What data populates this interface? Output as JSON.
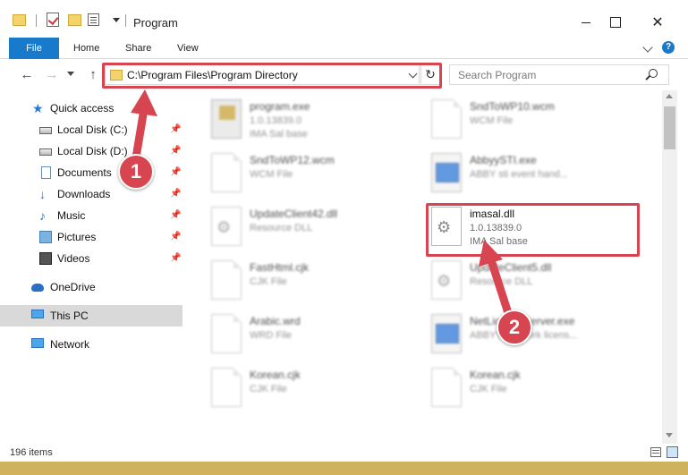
{
  "window": {
    "title": "Program",
    "minimize_label": "",
    "close_glyph": "✕"
  },
  "ribbon": {
    "tabs": [
      "File",
      "Home",
      "Share",
      "View"
    ],
    "help_glyph": "?"
  },
  "address_bar": {
    "path": "C:\\Program Files\\Program Directory",
    "refresh_glyph": "↻"
  },
  "search": {
    "placeholder": "Search Program"
  },
  "nav_glyphs": {
    "back": "←",
    "forward": "→",
    "up": "↑"
  },
  "nav_pane": {
    "items": [
      {
        "label": "Quick access",
        "icon": "star-icon",
        "pinned": false
      },
      {
        "label": "Local Disk (C:)",
        "icon": "drive-icon",
        "pinned": true
      },
      {
        "label": "Local Disk (D:)",
        "icon": "drive-icon",
        "pinned": true
      },
      {
        "label": "Documents",
        "icon": "documents-icon",
        "pinned": true
      },
      {
        "label": "Downloads",
        "icon": "download-icon",
        "pinned": true
      },
      {
        "label": "Music",
        "icon": "music-icon",
        "pinned": true
      },
      {
        "label": "Pictures",
        "icon": "pictures-icon",
        "pinned": true
      },
      {
        "label": "Videos",
        "icon": "videos-icon",
        "pinned": true
      },
      {
        "label": "OneDrive",
        "icon": "cloud-icon",
        "pinned": false
      },
      {
        "label": "This PC",
        "icon": "computer-icon",
        "pinned": false,
        "selected": true
      },
      {
        "label": "Network",
        "icon": "network-icon",
        "pinned": false
      }
    ],
    "pin_glyph": "📌"
  },
  "files": [
    {
      "name": "program.exe",
      "line2": "1.0.13839.0",
      "line3": "IMA Sal base",
      "icon": "program-icon"
    },
    {
      "name": "SndToWP10.wcm",
      "line2": "WCM File",
      "line3": "",
      "icon": "document-icon"
    },
    {
      "name": "SndToWP12.wcm",
      "line2": "WCM File",
      "line3": "",
      "icon": "document-icon"
    },
    {
      "name": "AbbyySTI.exe",
      "line2": "ABBY sti event hand...",
      "line3": "",
      "icon": "exe-icon"
    },
    {
      "name": "UpdateClient42.dll",
      "line2": "Resource DLL",
      "line3": "",
      "icon": "dll-icon"
    },
    {
      "name": "imasal.dll",
      "line2": "1.0.13839.0",
      "line3": "IMA Sal base",
      "icon": "dll-icon"
    },
    {
      "name": "FastHtml.cjk",
      "line2": "CJK File",
      "line3": "",
      "icon": "document-icon"
    },
    {
      "name": "UpdateClient5.dll",
      "line2": "Resource DLL",
      "line3": "",
      "icon": "dll-icon"
    },
    {
      "name": "Arabic.wrd",
      "line2": "WRD File",
      "line3": "",
      "icon": "document-icon"
    },
    {
      "name": "NetLicenseServer.exe",
      "line2": "ABBYY Network licens...",
      "line3": "",
      "icon": "exe-icon"
    },
    {
      "name": "Korean.cjk",
      "line2": "CJK File",
      "line3": "",
      "icon": "document-icon"
    },
    {
      "name": "Korean.cjk",
      "line2": "CJK File",
      "line3": "",
      "icon": "document-icon"
    }
  ],
  "status": {
    "item_count": "196 items"
  },
  "callouts": [
    {
      "number": "1"
    },
    {
      "number": "2"
    }
  ],
  "colors": {
    "accent": "#1979ca",
    "callout": "#d64550"
  }
}
